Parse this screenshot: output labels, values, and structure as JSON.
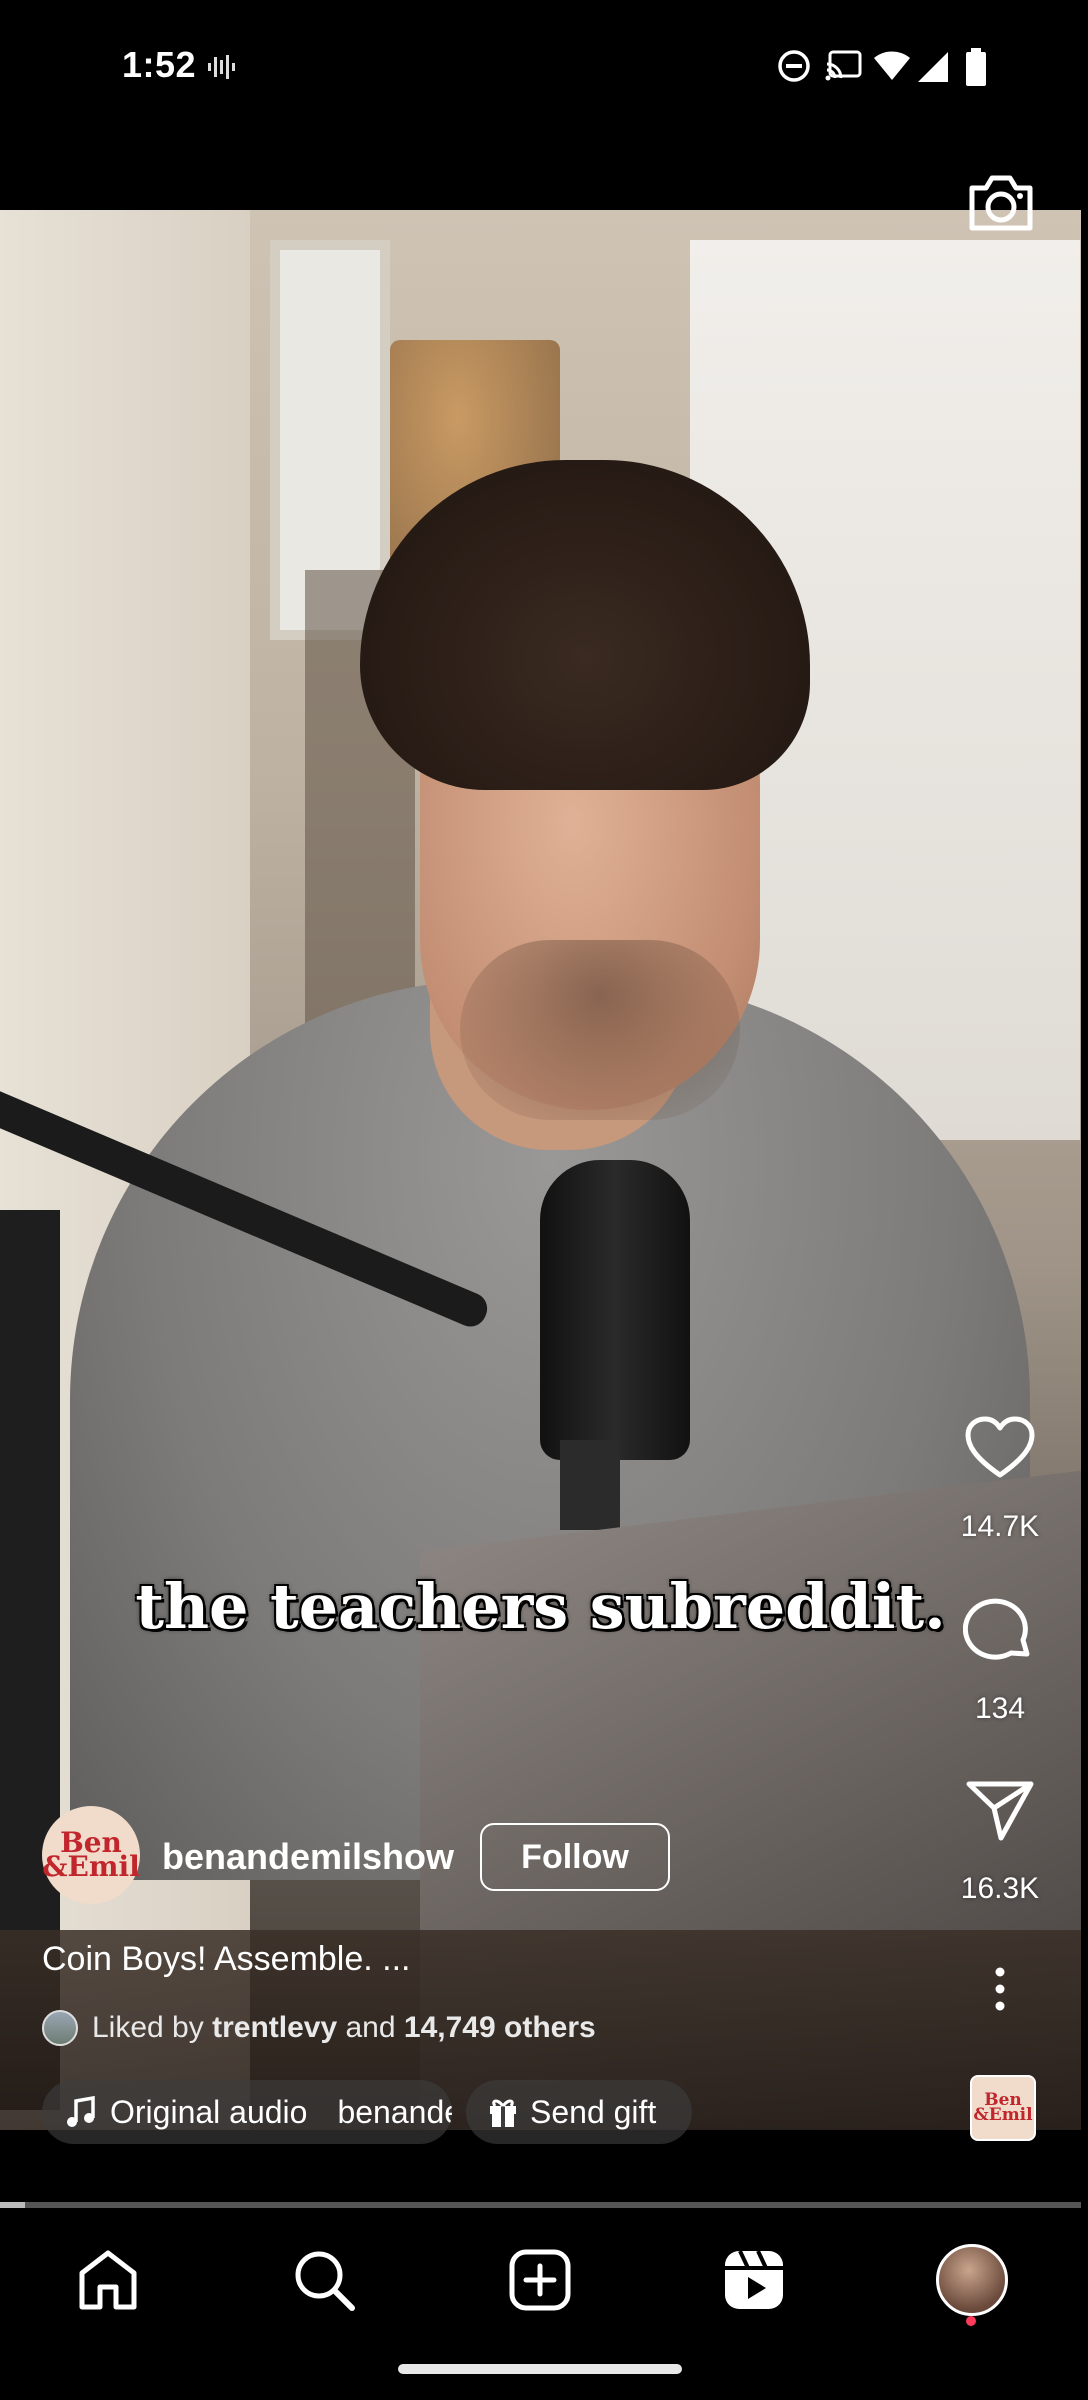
{
  "status_bar": {
    "time": "1:52"
  },
  "video": {
    "caption": "the teachers subreddit.",
    "camera_icon": "camera-icon"
  },
  "actions": {
    "likes": "14.7K",
    "comments": "134",
    "shares": "16.3K"
  },
  "author": {
    "avatar_text": "Ben &Emil",
    "username": "benandemilshow",
    "follow_label": "Follow",
    "description": "Coin Boys! Assemble. ..."
  },
  "liked_by": {
    "prefix": "Liked by",
    "user": "trentlevy",
    "connector": "and",
    "others": "14,749 others"
  },
  "audio": {
    "label": "Original audio",
    "artist": "benande"
  },
  "gift": {
    "label": "Send gift"
  },
  "progress": {
    "fraction": 0.023
  },
  "nav": {
    "items": [
      "home-icon",
      "search-icon",
      "create-icon",
      "reels-icon",
      "profile-avatar"
    ]
  }
}
